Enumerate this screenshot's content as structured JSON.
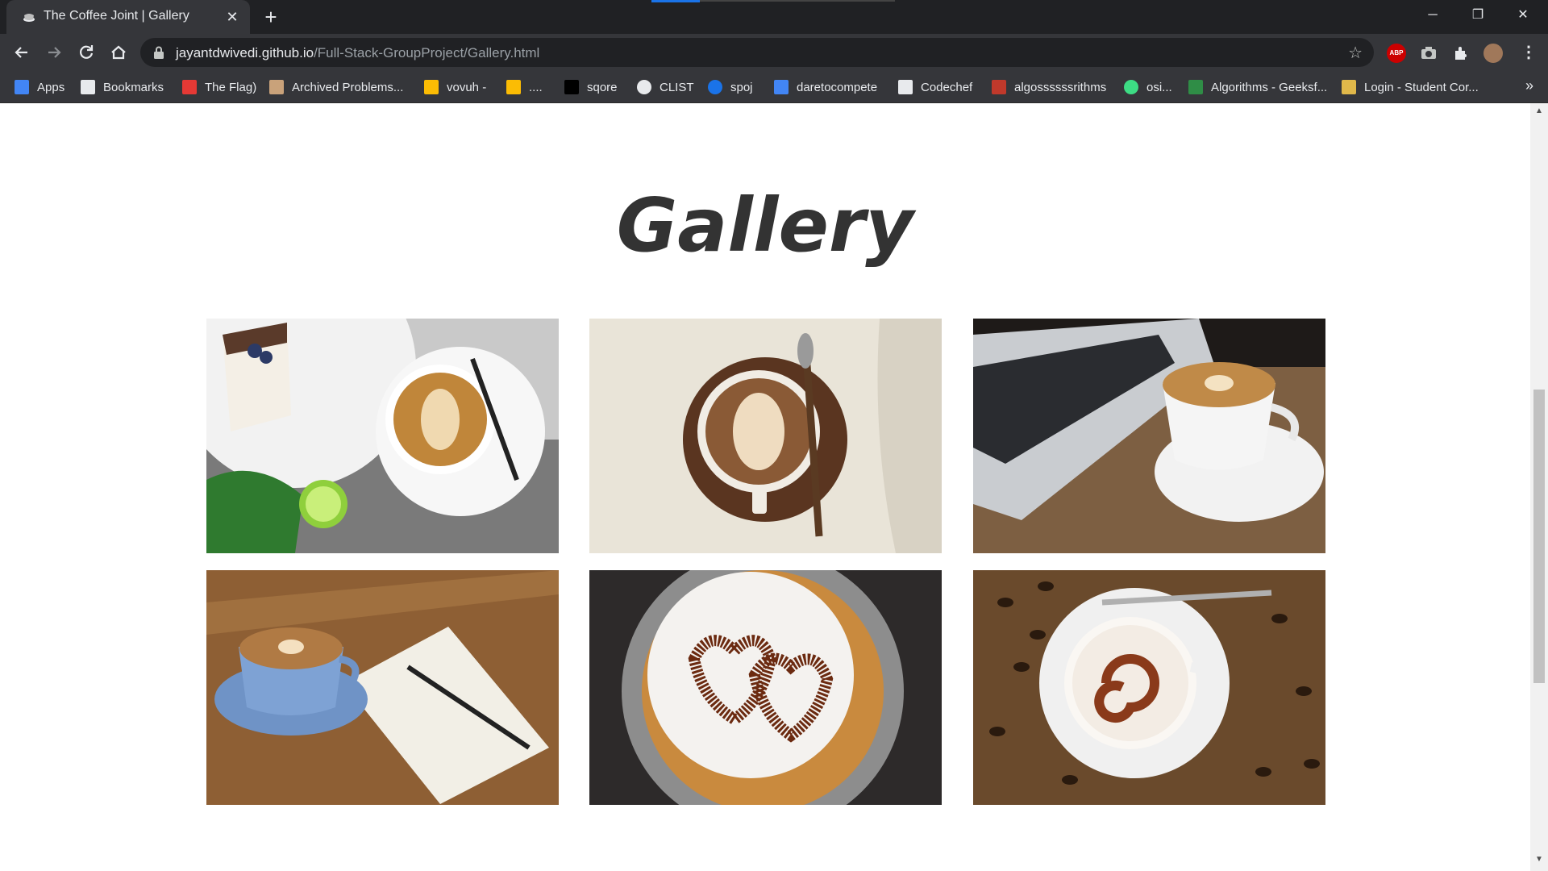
{
  "browser": {
    "tab_title": "The Coffee Joint | Gallery",
    "url_host": "jayantdwivedi.github.io",
    "url_path": "/Full-Stack-GroupProject/Gallery.html",
    "abp_label": "ABP",
    "bookmarks": [
      {
        "label": "Apps",
        "icon": "apps-grid-icon",
        "color": "#4285f4"
      },
      {
        "label": "Bookmarks",
        "icon": "star-icon",
        "color": "#e8eaed"
      },
      {
        "label": "The Flag)",
        "icon": "flag-icon",
        "color": "#e53935"
      },
      {
        "label": "Archived Problems...",
        "icon": "archive-icon",
        "color": "#c9a27a"
      },
      {
        "label": "vovuh -",
        "icon": "chart-icon",
        "color": "#fbbc04"
      },
      {
        "label": "....",
        "icon": "chart-icon",
        "color": "#fbbc04"
      },
      {
        "label": "sqore",
        "icon": "square-icon",
        "color": "#000000"
      },
      {
        "label": "CLIST",
        "icon": "globe-icon",
        "color": "#e8eaed"
      },
      {
        "label": "spoj",
        "icon": "spoj-icon",
        "color": "#1a73e8"
      },
      {
        "label": "daretocompete",
        "icon": "puzzle-icon",
        "color": "#4285f4"
      },
      {
        "label": "Codechef",
        "icon": "codechef-icon",
        "color": "#e8eaed"
      },
      {
        "label": "algossssssrithms",
        "icon": "search-icon",
        "color": "#c0392b"
      },
      {
        "label": "osi...",
        "icon": "osi-icon",
        "color": "#3ddc84"
      },
      {
        "label": "Algorithms - Geeksf...",
        "icon": "gfg-icon",
        "color": "#2f8d46"
      },
      {
        "label": "Login - Student Cor...",
        "icon": "crown-icon",
        "color": "#e0b84a"
      }
    ]
  },
  "page": {
    "heading": "Gallery",
    "photos": [
      {
        "name": "latte-with-cake",
        "bg": "#d8d8d8"
      },
      {
        "name": "latte-on-wooden-saucer",
        "bg": "#e6e1d6"
      },
      {
        "name": "latte-beside-laptop",
        "bg": "#8a6a4a"
      },
      {
        "name": "blue-cup-with-notebook",
        "bg": "#9a6b3e"
      },
      {
        "name": "cappuccino-heart-art",
        "bg": "#3a2a2a"
      },
      {
        "name": "cappuccino-with-beans",
        "bg": "#6b4a2a"
      }
    ]
  }
}
